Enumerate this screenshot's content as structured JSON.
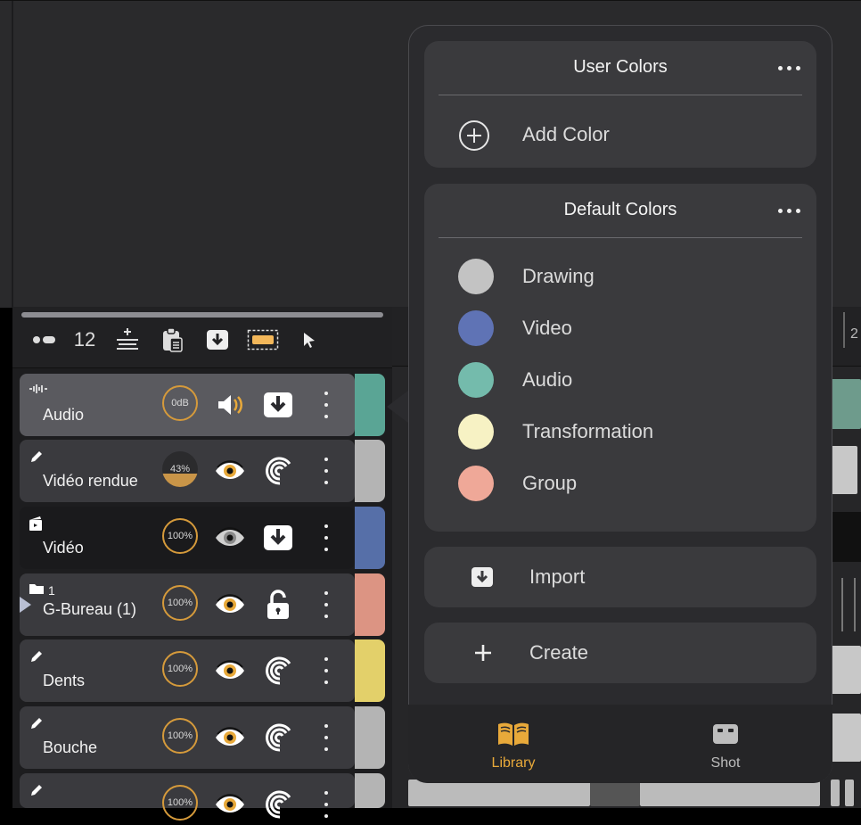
{
  "toolbar": {
    "frame_number": "12",
    "icons": [
      "onion-skin-icon",
      "add-layer-icon",
      "clipboard-icon",
      "import-icon",
      "selection-rect-icon",
      "pointer-icon"
    ]
  },
  "timeline": {
    "ruler_label": "2"
  },
  "layers": [
    {
      "name": "Audio",
      "type": "audio-wave-icon",
      "badge": "0dB",
      "icon2": "speaker-icon",
      "icon3": "import-icon",
      "color": "#5aa595",
      "selected": true
    },
    {
      "name": "Vidéo rendue",
      "type": "pencil-icon",
      "badge": "43%",
      "icon2": "eye-icon",
      "icon3": "onion-icon",
      "color": "#b4b4b4"
    },
    {
      "name": "Vidéo",
      "type": "clapper-icon",
      "badge": "100%",
      "icon2": "eye-icon",
      "icon3": "import-icon",
      "color": "#566fa8"
    },
    {
      "name": "G-Bureau (1)",
      "num": "1",
      "type": "folder-icon",
      "badge": "100%",
      "icon2": "eye-icon",
      "icon3": "unlock-icon",
      "color": "#dc9483"
    },
    {
      "name": "Dents",
      "type": "pencil-icon",
      "badge": "100%",
      "icon2": "eye-icon",
      "icon3": "onion-icon",
      "color": "#e3d06a"
    },
    {
      "name": "Bouche",
      "type": "pencil-icon",
      "badge": "100%",
      "icon2": "eye-icon",
      "icon3": "onion-icon",
      "color": "#b4b4b4"
    },
    {
      "name": "",
      "type": "pencil-icon",
      "badge": "100%",
      "icon2": "eye-icon",
      "icon3": "onion-icon",
      "color": "#b4b4b4"
    }
  ],
  "popover": {
    "user_colors": {
      "title": "User Colors",
      "add_label": "Add Color"
    },
    "default_colors": {
      "title": "Default Colors",
      "items": [
        {
          "label": "Drawing",
          "color": "#c3c3c3"
        },
        {
          "label": "Video",
          "color": "#5f73b5"
        },
        {
          "label": "Audio",
          "color": "#74bbac"
        },
        {
          "label": "Transformation",
          "color": "#f7f2c4"
        },
        {
          "label": "Group",
          "color": "#efa898"
        }
      ]
    },
    "import_label": "Import",
    "create_label": "Create",
    "tabs": [
      {
        "label": "Library",
        "icon": "book-icon",
        "active": true,
        "color": "#e8a93a"
      },
      {
        "label": "Shot",
        "icon": "shot-icon",
        "active": false,
        "color": "#bdbdbd"
      }
    ]
  }
}
